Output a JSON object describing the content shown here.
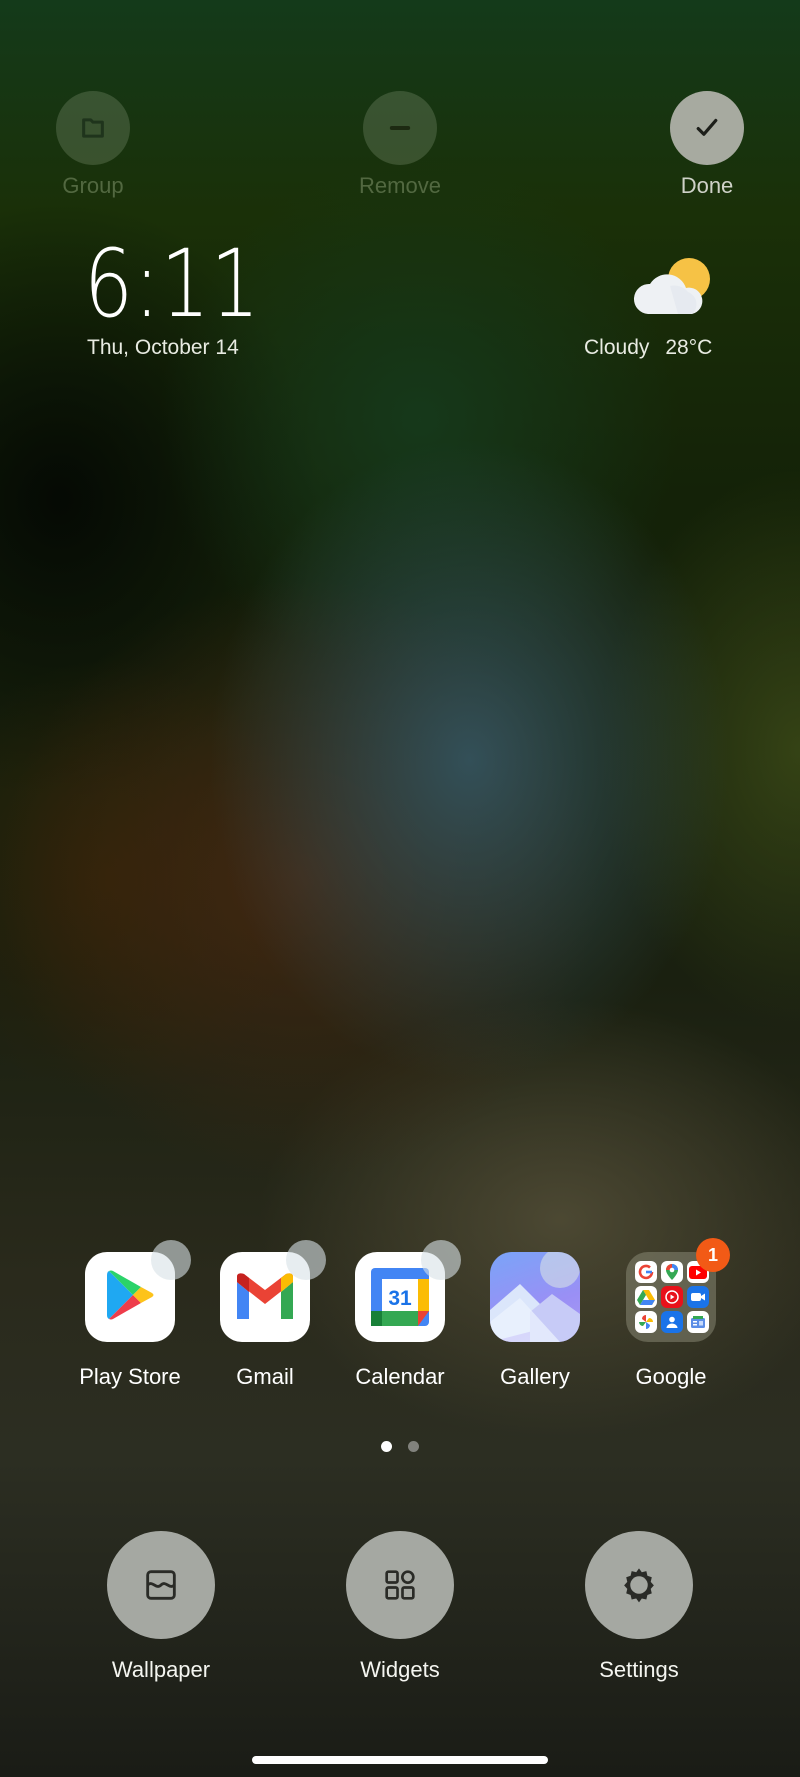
{
  "edit_bar": {
    "group": {
      "label": "Group",
      "icon": "folder-icon",
      "enabled": false
    },
    "remove": {
      "label": "Remove",
      "icon": "minus-icon",
      "enabled": false
    },
    "done": {
      "label": "Done",
      "icon": "check-icon",
      "enabled": true
    }
  },
  "clock": {
    "time": "6:11",
    "date": "Thu, October 14"
  },
  "weather": {
    "icon": "partly-cloudy-icon",
    "condition": "Cloudy",
    "temperature": "28°C"
  },
  "apps": [
    {
      "label": "Play Store",
      "icon": "play-store-icon"
    },
    {
      "label": "Gmail",
      "icon": "gmail-icon"
    },
    {
      "label": "Calendar",
      "icon": "calendar-icon",
      "day": "31"
    },
    {
      "label": "Gallery",
      "icon": "gallery-icon"
    },
    {
      "label": "Google",
      "icon": "google-folder-icon",
      "badge": "1",
      "folder_items": [
        "google-search",
        "google-maps",
        "youtube",
        "google-drive",
        "youtube-music",
        "google-duo",
        "google-photos",
        "contacts",
        "google-news"
      ]
    }
  ],
  "pager": {
    "pages": 2,
    "current": 1
  },
  "actions": [
    {
      "label": "Wallpaper",
      "icon": "wallpaper-icon"
    },
    {
      "label": "Widgets",
      "icon": "widgets-icon"
    },
    {
      "label": "Settings",
      "icon": "gear-icon"
    }
  ],
  "colors": {
    "badge": "#f25a16",
    "active_button": "#a7aaa0",
    "action_button": "#a5a8a2"
  }
}
